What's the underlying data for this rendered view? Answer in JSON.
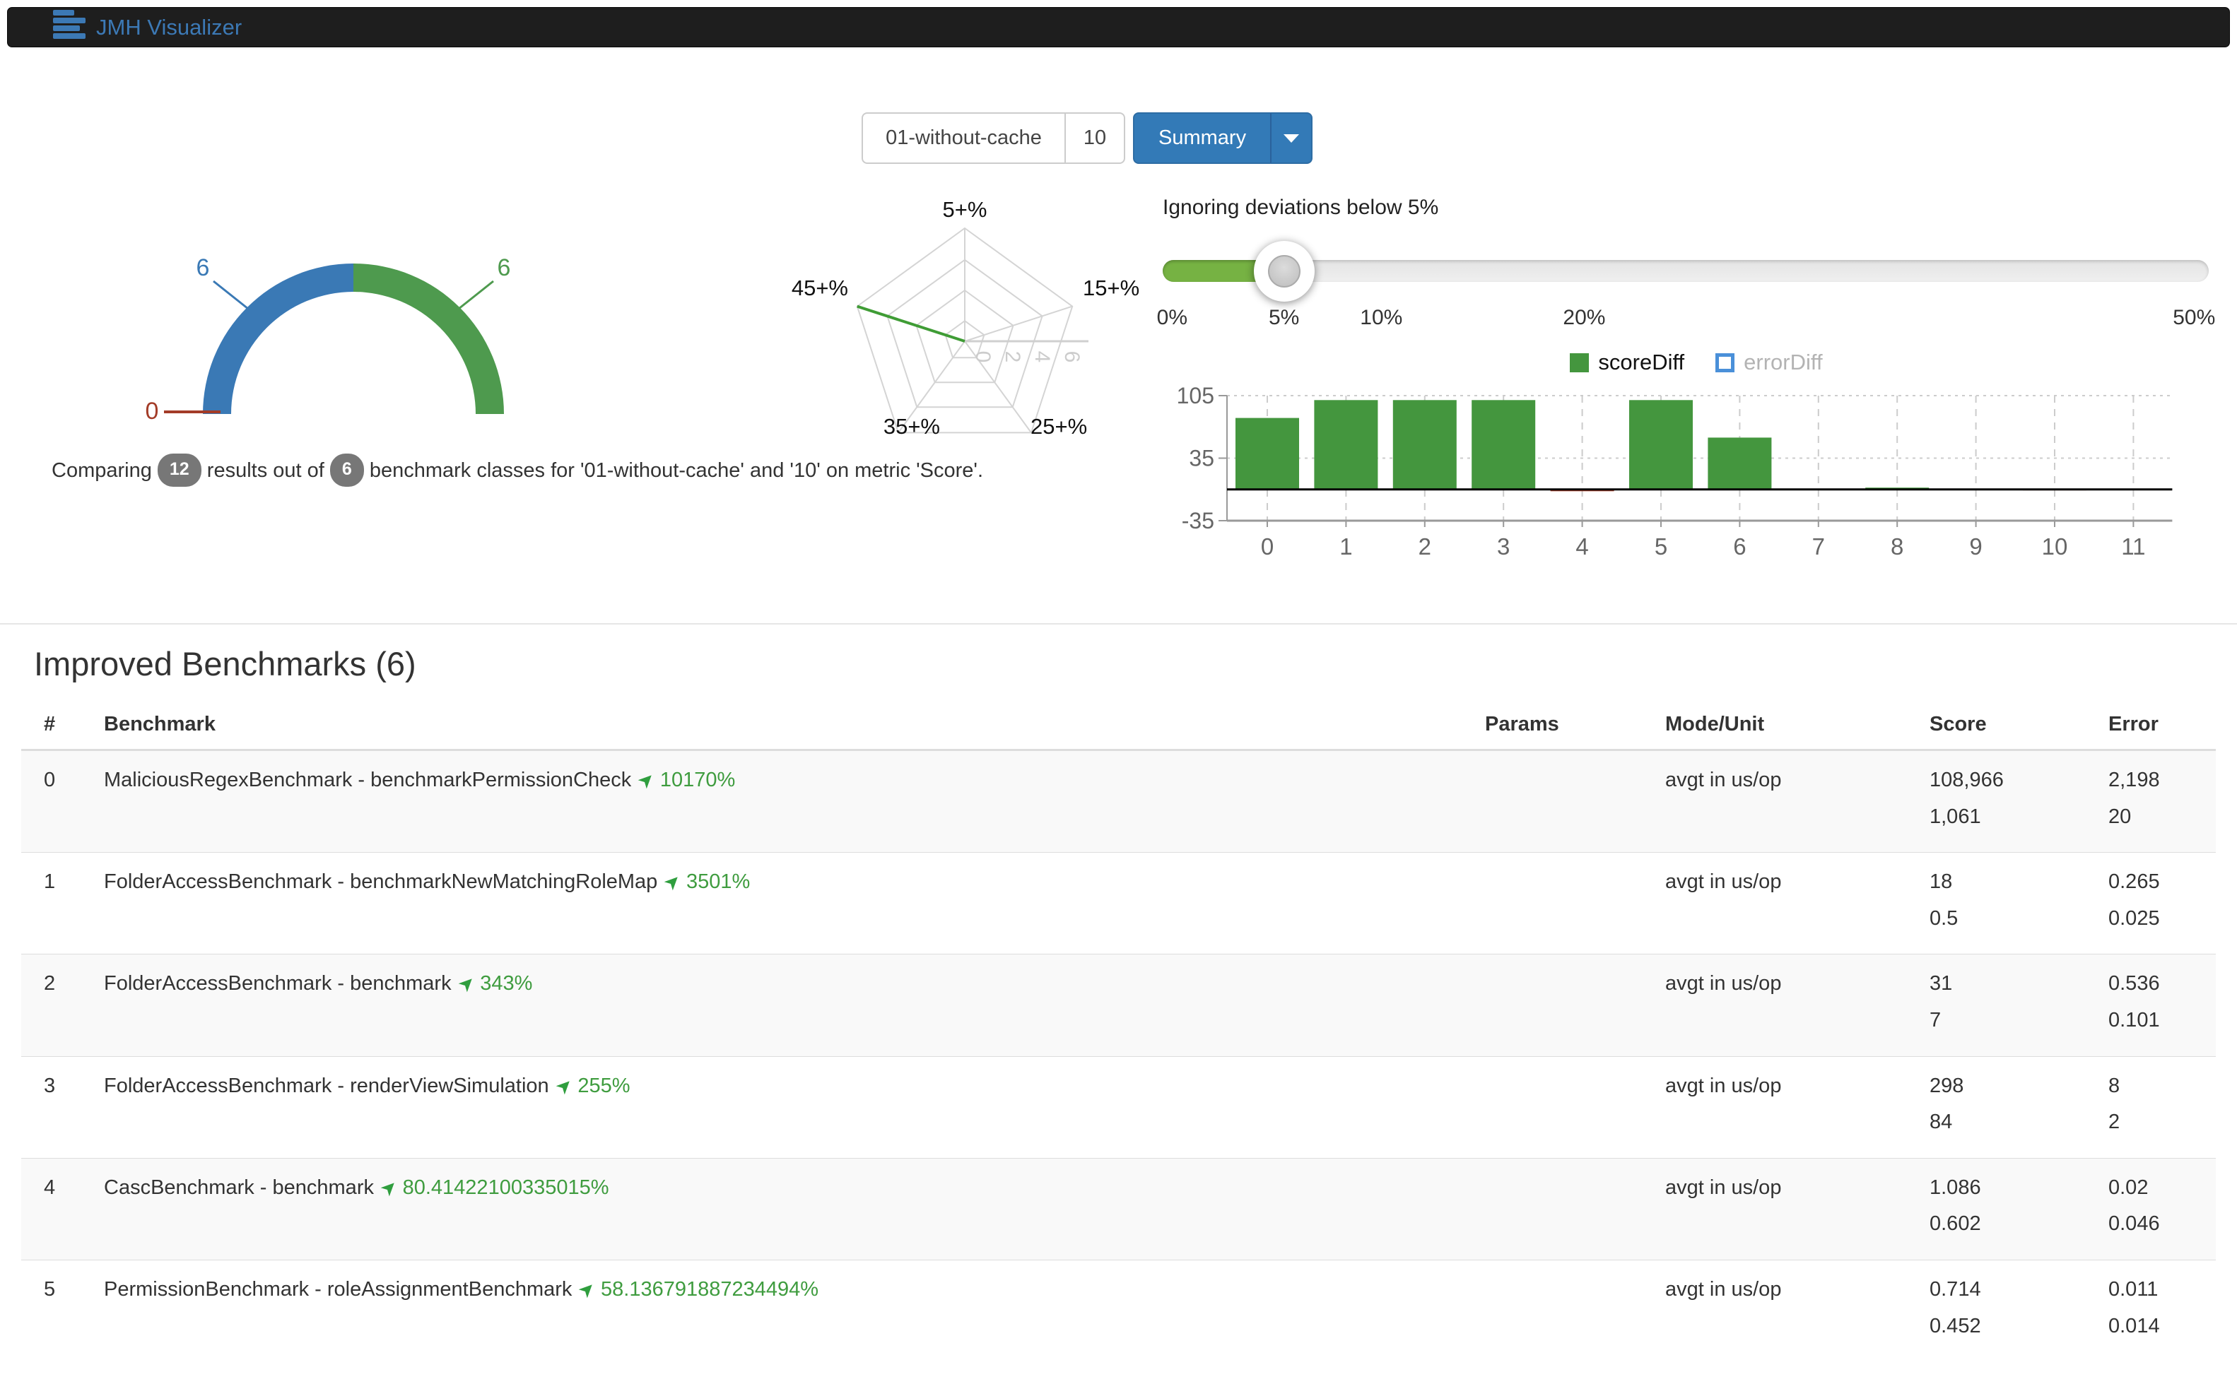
{
  "navbar": {
    "brand": "JMH Visualizer"
  },
  "controls": {
    "run_left": "01-without-cache",
    "run_right": "10",
    "view_button": "Summary"
  },
  "caption": {
    "prefix": "Comparing",
    "results_badge": "12",
    "middle": "results out of",
    "classes_badge": "6",
    "suffix": "benchmark classes for '01-without-cache' and '10' on metric 'Score'."
  },
  "slider": {
    "title": "Ignoring deviations below 5%",
    "value": "5%",
    "handle_pos_pct": 11.6,
    "fill_color": "#76b243",
    "tick_labels": [
      {
        "text": "0%",
        "pos_pct": 0.9
      },
      {
        "text": "5%",
        "pos_pct": 11.6
      },
      {
        "text": "10%",
        "pos_pct": 20.9
      },
      {
        "text": "20%",
        "pos_pct": 40.3
      },
      {
        "text": "50%",
        "pos_pct": 98.6
      }
    ]
  },
  "chart_data": [
    {
      "type": "pie",
      "name": "summary-gauge",
      "style": "half-donut",
      "slices": [
        {
          "label": "6",
          "value": 6,
          "color": "#3a79b5"
        },
        {
          "label": "6",
          "value": 6,
          "color": "#4e9a4e"
        },
        {
          "label": "0",
          "value": 0,
          "color": "#a33c28"
        }
      ]
    },
    {
      "type": "radar",
      "name": "deviation-radar",
      "axes": [
        "5+%",
        "15+%",
        "25+%",
        "35+%",
        "45+%"
      ],
      "tick_labels": [
        "0",
        "2",
        "4",
        "6"
      ],
      "max": 6,
      "series": [
        {
          "name": "scoreDiff",
          "color": "#3f9c35",
          "values": [
            0,
            0,
            0,
            0,
            6
          ]
        }
      ]
    },
    {
      "type": "bar",
      "name": "score-diff-bars",
      "categories": [
        "0",
        "1",
        "2",
        "3",
        "4",
        "5",
        "6",
        "7",
        "8",
        "9",
        "10",
        "11"
      ],
      "series": [
        {
          "name": "scoreDiff",
          "color": "#44963e",
          "negative_color": "#a33c28",
          "visible": true,
          "values": [
            80,
            100,
            100,
            100,
            -2,
            100,
            58,
            0,
            2,
            0,
            -1,
            0
          ]
        },
        {
          "name": "errorDiff",
          "color": "#337ab7",
          "visible": false,
          "values": []
        }
      ],
      "yticks": [
        105,
        35,
        -35
      ],
      "ylim": [
        -35,
        105
      ],
      "legend_position": "top"
    }
  ],
  "section": {
    "title": "Improved Benchmarks (6)"
  },
  "table": {
    "columns": [
      "#",
      "Benchmark",
      "Params",
      "Mode/Unit",
      "Score",
      "Error"
    ],
    "rows": [
      {
        "index": "0",
        "benchmark": "MaliciousRegexBenchmark - benchmarkPermissionCheck",
        "change": "10170%",
        "params": "",
        "mode_unit": "avgt in us/op",
        "score": [
          "108,966",
          "1,061"
        ],
        "error": [
          "2,198",
          "20"
        ]
      },
      {
        "index": "1",
        "benchmark": "FolderAccessBenchmark - benchmarkNewMatchingRoleMap",
        "change": "3501%",
        "params": "",
        "mode_unit": "avgt in us/op",
        "score": [
          "18",
          "0.5"
        ],
        "error": [
          "0.265",
          "0.025"
        ]
      },
      {
        "index": "2",
        "benchmark": "FolderAccessBenchmark - benchmark",
        "change": "343%",
        "params": "",
        "mode_unit": "avgt in us/op",
        "score": [
          "31",
          "7"
        ],
        "error": [
          "0.536",
          "0.101"
        ]
      },
      {
        "index": "3",
        "benchmark": "FolderAccessBenchmark - renderViewSimulation",
        "change": "255%",
        "params": "",
        "mode_unit": "avgt in us/op",
        "score": [
          "298",
          "84"
        ],
        "error": [
          "8",
          "2"
        ]
      },
      {
        "index": "4",
        "benchmark": "CascBenchmark - benchmark",
        "change": "80.41422100335015%",
        "params": "",
        "mode_unit": "avgt in us/op",
        "score": [
          "1.086",
          "0.602"
        ],
        "error": [
          "0.02",
          "0.046"
        ]
      },
      {
        "index": "5",
        "benchmark": "PermissionBenchmark - roleAssignmentBenchmark",
        "change": "58.136791887234494%",
        "params": "",
        "mode_unit": "avgt in us/op",
        "score": [
          "0.714",
          "0.452"
        ],
        "error": [
          "0.011",
          "0.014"
        ]
      }
    ]
  },
  "colors": {
    "accent_blue": "#337ab7",
    "improve_green": "#3f9c3f",
    "regress_red": "#a33c28",
    "navbar_bg": "#1e1e1e"
  }
}
